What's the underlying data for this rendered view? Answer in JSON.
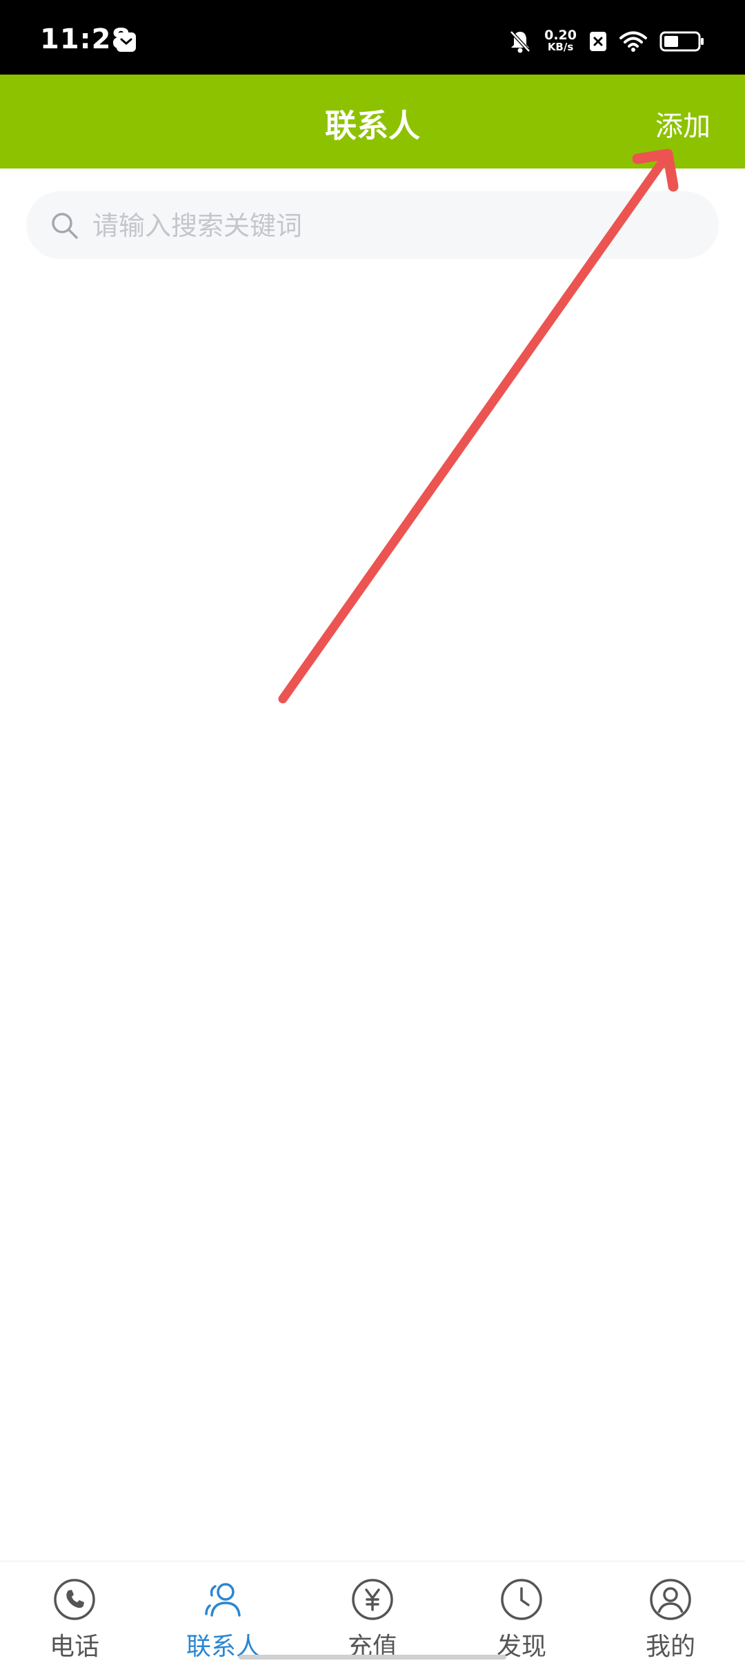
{
  "status_bar": {
    "time": "11:28",
    "net_speed_value": "0.20",
    "net_speed_unit": "KB/s",
    "icons": [
      "message-icon",
      "bell-muted-icon",
      "sim-off-icon",
      "wifi-icon",
      "battery-icon"
    ]
  },
  "header": {
    "title": "联系人",
    "add_label": "添加"
  },
  "search": {
    "placeholder": "请输入搜索关键词",
    "value": ""
  },
  "tabs": [
    {
      "label": "电话",
      "icon": "phone-icon",
      "active": false
    },
    {
      "label": "联系人",
      "icon": "contacts-icon",
      "active": true
    },
    {
      "label": "充值",
      "icon": "yuan-icon",
      "active": false
    },
    {
      "label": "发现",
      "icon": "clock-icon",
      "active": false
    },
    {
      "label": "我的",
      "icon": "profile-icon",
      "active": false
    }
  ],
  "colors": {
    "header_bg": "#8dc200",
    "active_tab": "#2a86d1",
    "inactive_tab": "#555555",
    "arrow": "#ec5451"
  }
}
